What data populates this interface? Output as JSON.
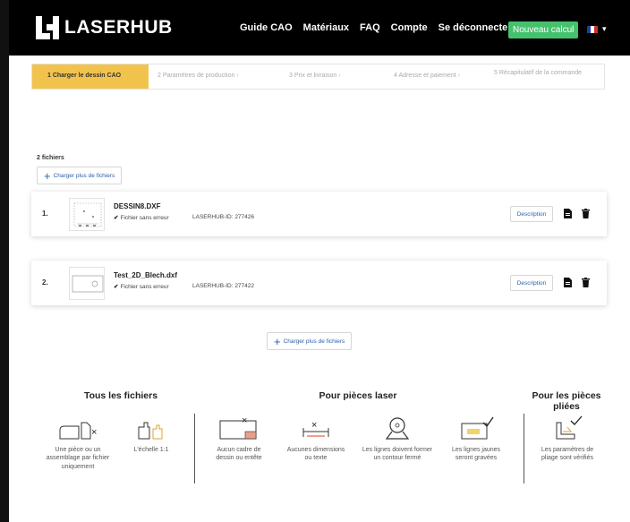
{
  "brand": {
    "name": "LASERHUB"
  },
  "nav": {
    "links": [
      "Guide CAO",
      "Matériaux",
      "FAQ",
      "Compte",
      "Se déconnecter"
    ],
    "cta_label": "Nouveau calcul",
    "language_caret": "▾"
  },
  "stepper": {
    "steps": [
      "1 Charger le dessin CAO",
      "2 Paramètres de production",
      "3 Prix et livraison",
      "4 Adresse et paiement",
      "5 Récapitulatif de la commande"
    ]
  },
  "files": {
    "count_label": "2 fichiers",
    "upload_label": "Charger plus de fichiers",
    "items": [
      {
        "index": "1.",
        "name": "DESSIN8.DXF",
        "status": "Fichier sans erreur",
        "id": "LASERHUB-ID: 277426",
        "description_label": "Description"
      },
      {
        "index": "2.",
        "name": "Test_2D_Blech.dxf",
        "status": "Fichier sans erreur",
        "id": "LASERHUB-ID: 277422",
        "description_label": "Description"
      }
    ]
  },
  "rules": {
    "sections": [
      {
        "title": "Tous les fichiers"
      },
      {
        "title": "Pour pièces laser"
      },
      {
        "title": "Pour les pièces pliées"
      }
    ],
    "items": [
      {
        "caption": "Une pièce ou un assemblage par fichier uniquement",
        "icon": "single-part-icon"
      },
      {
        "caption": "L'échelle 1:1",
        "icon": "scale-icon"
      },
      {
        "caption": "Aucun cadre de dessin ou entête",
        "icon": "no-frame-icon"
      },
      {
        "caption": "Aucunes dimensions ou texte",
        "icon": "no-dimensions-icon"
      },
      {
        "caption": "Les lignes doivent former un contour fermé",
        "icon": "closed-contour-icon"
      },
      {
        "caption": "Les lignes jaunes seront gravées",
        "icon": "engraving-icon"
      },
      {
        "caption": "Les paramètres de pliage sont vérifiés",
        "icon": "bend-check-icon"
      }
    ]
  },
  "colors": {
    "accent_yellow": "#f2c34c",
    "cta_green": "#45c16d",
    "link_blue": "#2a5fa8"
  }
}
